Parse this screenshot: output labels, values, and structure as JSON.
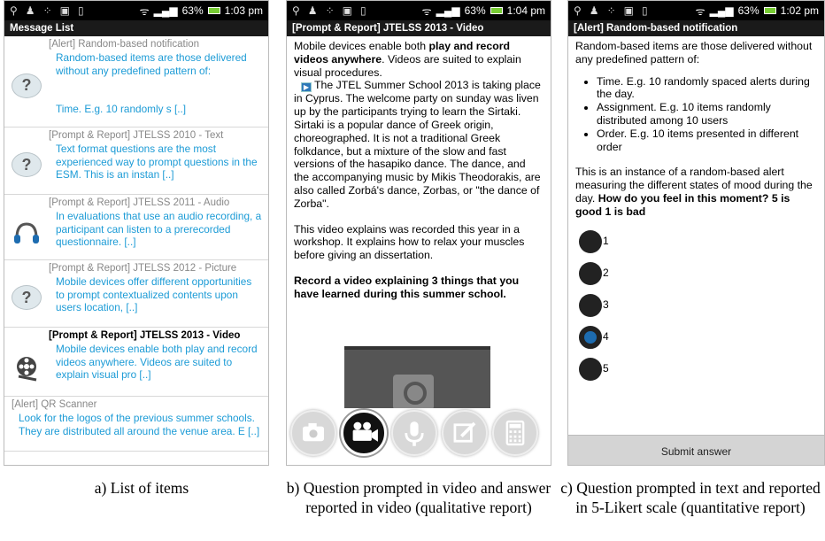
{
  "panel_a": {
    "status": {
      "battery": "63%",
      "time": "1:03 pm"
    },
    "title": "Message List",
    "items": [
      {
        "title": "[Alert] Random-based notification",
        "body": "Random-based items are those delivered without any predefined pattern of:\n\n\nTime. E.g. 10 randomly s [..]",
        "icon": "question-icon"
      },
      {
        "title": "[Prompt & Report] JTELSS 2010 - Text",
        "body": "Text format questions are the most experienced way to prompt questions in the ESM. This is an instan [..]",
        "icon": "question-icon"
      },
      {
        "title": "[Prompt & Report] JTELSS 2011 - Audio",
        "body": "In evaluations that use an audio recording, a participant can listen to a prerecorded questionnaire. [..]",
        "icon": "headphones-icon"
      },
      {
        "title": "[Prompt & Report] JTELSS 2012 - Picture",
        "body": "Mobile devices offer different opportunities to prompt contextualized contents upon users location, [..]",
        "icon": "question-icon"
      },
      {
        "title": "[Prompt & Report] JTELSS 2013 - Video",
        "body": "Mobile devices enable both play and record videos anywhere. Videos are  suited to explain visual pro [..]",
        "icon": "film-reel-icon"
      },
      {
        "title": "[Alert] QR Scanner",
        "body": "Look for the logos of the previous summer schools. They are distributed all around the venue area. E [..]",
        "icon": ""
      }
    ]
  },
  "panel_b": {
    "status": {
      "battery": "63%",
      "time": "1:04 pm"
    },
    "title": "[Prompt & Report] JTELSS 2013 - Video",
    "p1_pre": "Mobile devices enable both ",
    "p1_bold": "play and record videos anywhere",
    "p1_post": ". Videos are  suited to explain visual procedures.",
    "p2_indent": "The JTEL Summer School 2013 is taking place in Cyprus. The welcome party on",
    "p2_rest": "sunday was liven up by the participants trying to learn the Sirtaki.",
    "p3": "Sirtaki is a popular dance of Greek origin, choreographed. It is not a traditional Greek folkdance, but a mixture of the slow and fast versions of the hasapiko dance. The dance, and the accompanying music by Mikis Theodorakis, are also called Zorbá's dance, Zorbas, or \"the dance of Zorba\".",
    "p4": "This video explains was recorded this year in a workshop. It explains how to relax your muscles before giving an dissertation.",
    "p5": "Record a video explaining 3 things that you have learned during this summer school.",
    "tools": [
      "camera-icon",
      "video-camera-icon",
      "microphone-icon",
      "edit-icon",
      "calculator-icon"
    ],
    "active_tool": "video-camera-icon"
  },
  "panel_c": {
    "status": {
      "battery": "63%",
      "time": "1:02 pm"
    },
    "title": "[Alert] Random-based notification",
    "intro": "Random-based items are those delivered without any predefined pattern of:",
    "bullets": [
      "Time. E.g. 10 randomly spaced alerts during the day.",
      "Assignment. E.g. 10 items randomly distributed among 10 users",
      "Order. E.g. 10 items presented in different order"
    ],
    "question_pre": "This is an instance of a random-based alert measuring the different states of mood during the day. ",
    "question_bold": "How do you feel in this moment? 5 is good 1 is bad",
    "options": [
      "1",
      "2",
      "3",
      "4",
      "5"
    ],
    "selected": "4",
    "submit_label": "Submit answer"
  },
  "captions": {
    "a": "a) List of items",
    "b": "b) Question prompted in video and answer reported in video (qualitative report)",
    "c": "c) Question prompted in text and reported in 5-Likert scale (quantitative report)"
  }
}
